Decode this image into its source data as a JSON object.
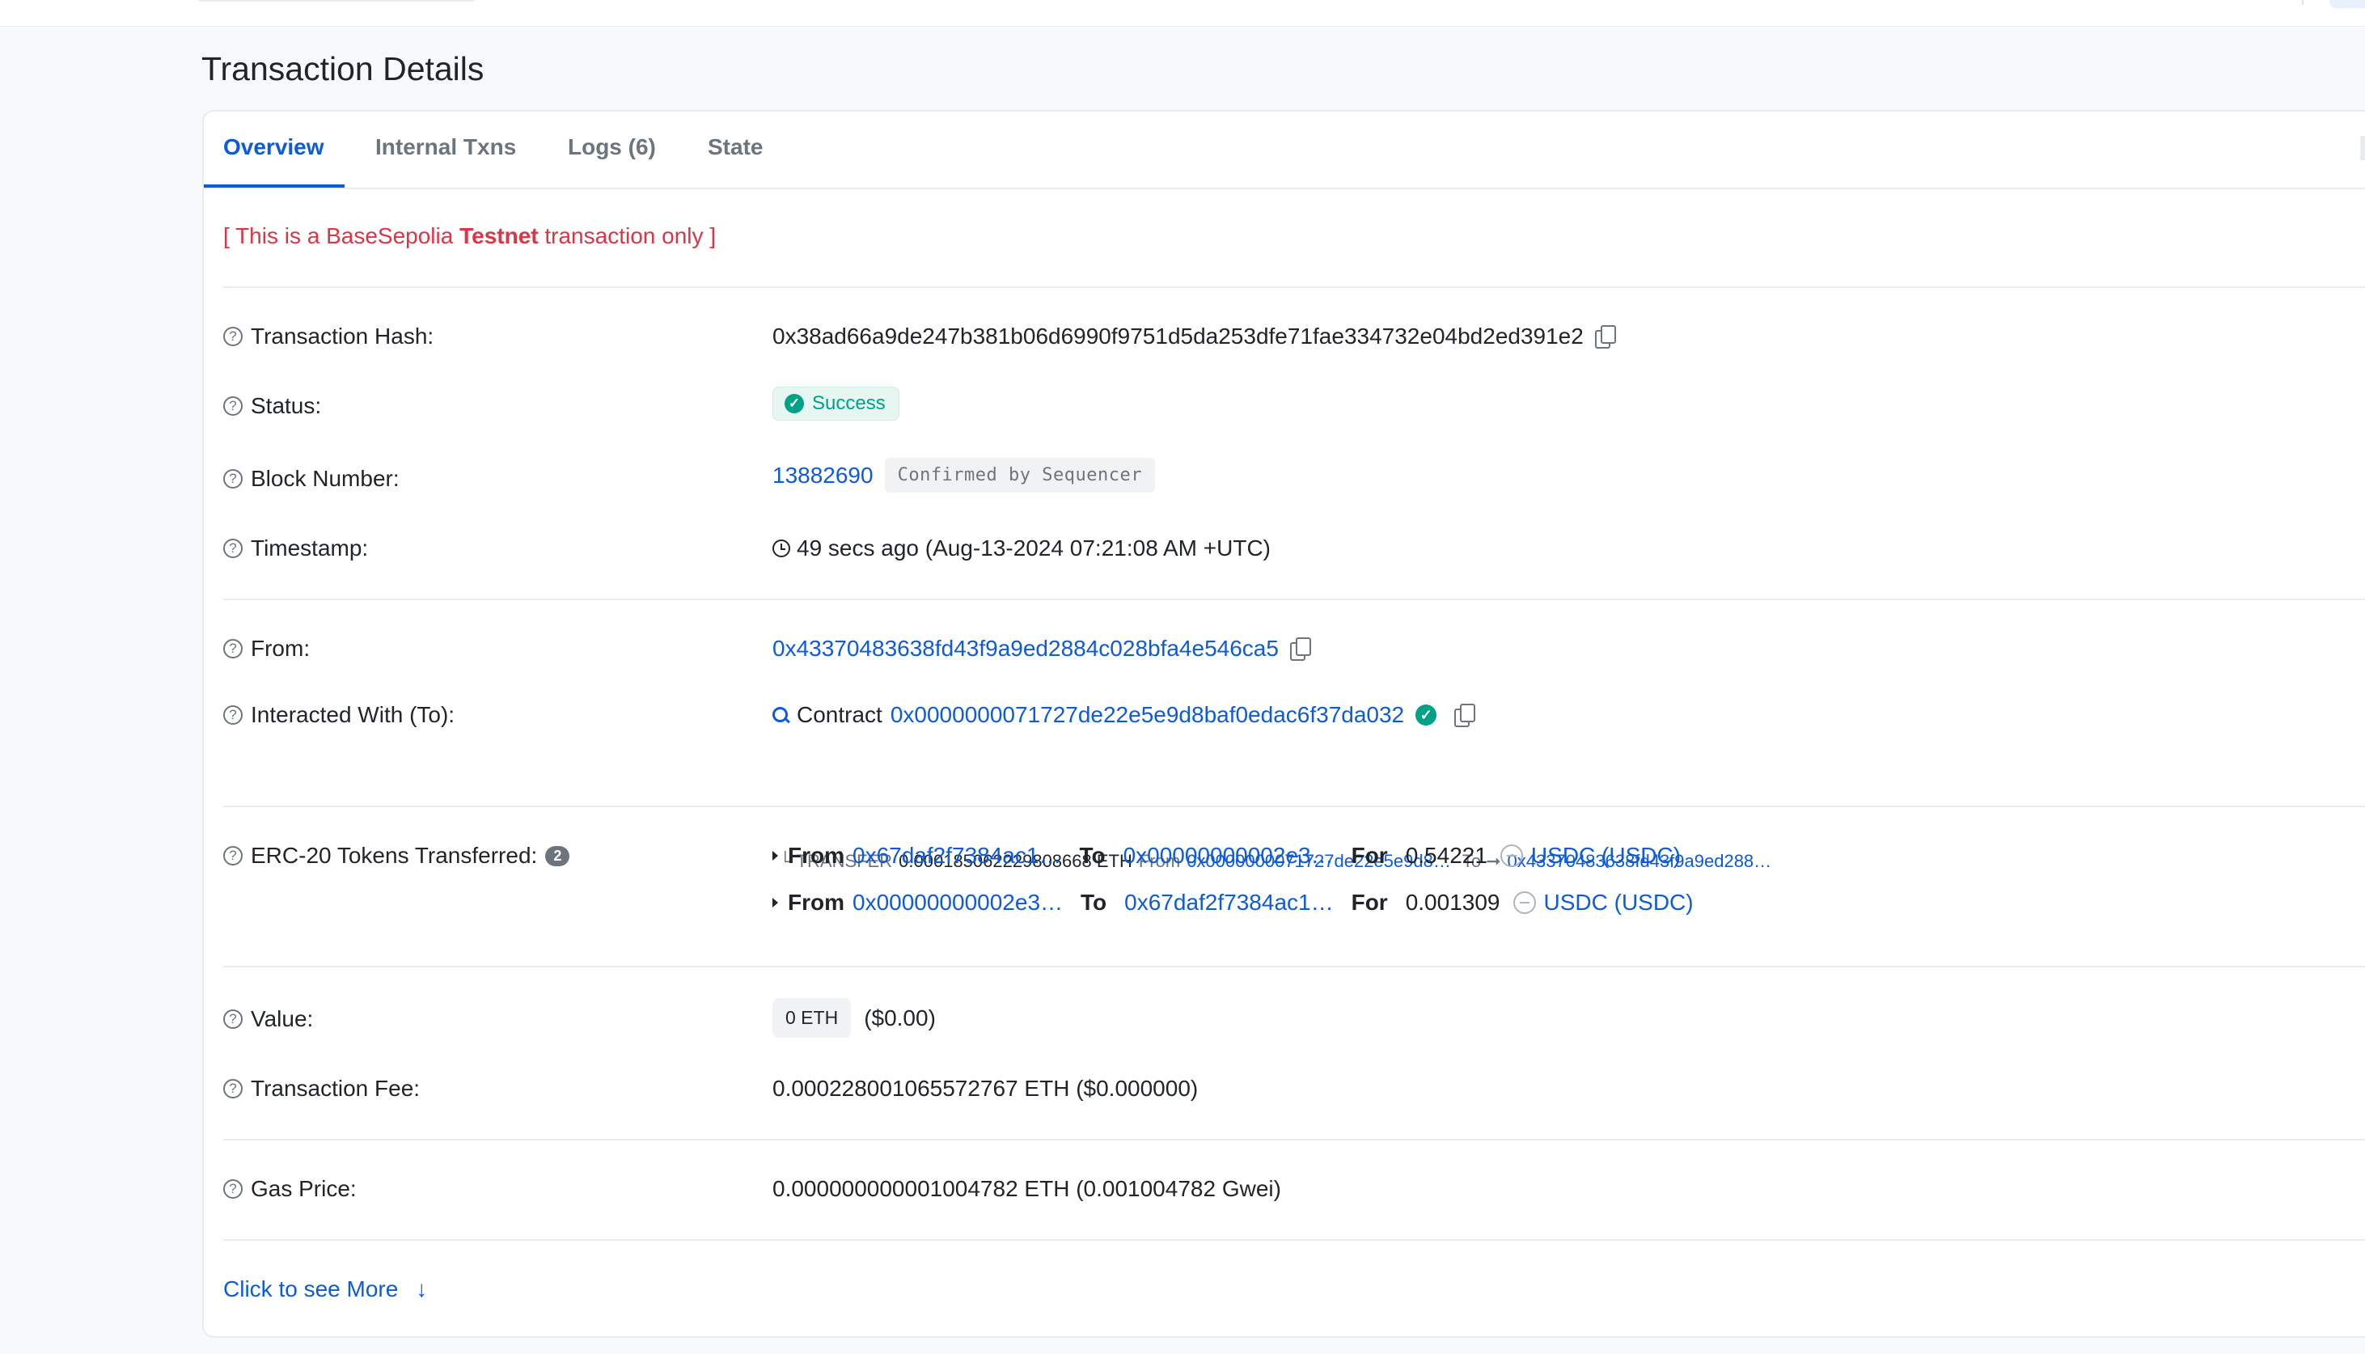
{
  "page_title": "Transaction Details",
  "tabs": [
    {
      "label": "Overview",
      "active": true
    },
    {
      "label": "Internal Txns",
      "active": false
    },
    {
      "label": "Logs (6)",
      "active": false
    },
    {
      "label": "State",
      "active": false
    }
  ],
  "notice": {
    "prefix": "[ This is a BaseSepolia ",
    "strong": "Testnet",
    "suffix": " transaction only ]"
  },
  "rows": {
    "tx_hash": {
      "label": "Transaction Hash:",
      "value": "0x38ad66a9de247b381b06d6990f9751d5da253dfe71fae334732e04bd2ed391e2"
    },
    "status": {
      "label": "Status:",
      "value": "Success"
    },
    "block": {
      "label": "Block Number:",
      "value": "13882690",
      "badge": "Confirmed by Sequencer"
    },
    "timestamp": {
      "label": "Timestamp:",
      "value": "49 secs ago (Aug-13-2024 07:21:08 AM +UTC)"
    },
    "from": {
      "label": "From:",
      "value": "0x43370483638fd43f9a9ed2884c028bfa4e546ca5"
    },
    "to": {
      "label": "Interacted With (To):",
      "prefix": "Contract",
      "value": "0x0000000071727de22e5e9d8baf0edac6f37da032",
      "transfer": {
        "label": "TRANSFER",
        "amount": "0.000185062229808668 ETH",
        "from_label": "From",
        "from": "0x0000000071727de22e5e9d8…",
        "to_label": "To",
        "to": "0x43370483638fd43f9a9ed288…"
      }
    },
    "erc20": {
      "label": "ERC-20 Tokens Transferred:",
      "count": "2",
      "transfers": [
        {
          "from_label": "From",
          "from": "0x67daf2f7384ac1…",
          "to_label": "To",
          "to": "0x00000000002e3…",
          "for_label": "For",
          "amount": "0.54221",
          "token": "USDC (USDC)"
        },
        {
          "from_label": "From",
          "from": "0x00000000002e3…",
          "to_label": "To",
          "to": "0x67daf2f7384ac1…",
          "for_label": "For",
          "amount": "0.001309",
          "token": "USDC (USDC)"
        }
      ]
    },
    "value": {
      "label": "Value:",
      "badge": "0 ETH",
      "usd": "($0.00)"
    },
    "fee": {
      "label": "Transaction Fee:",
      "value": "0.000228001065572767 ETH ($0.000000)"
    },
    "gas": {
      "label": "Gas Price:",
      "value": "0.000000000001004782 ETH (0.001004782 Gwei)"
    }
  },
  "more_link": "Click to see More",
  "icons": {
    "help": "question-circle-icon",
    "copy": "copy-icon",
    "success": "check-circle-icon",
    "clock": "clock-icon",
    "contract": "search-icon",
    "verified": "verified-check-icon",
    "token": "token-icon",
    "expand": "caret-right-icon",
    "more": "arrow-down-icon"
  },
  "colors": {
    "link": "#0d5bd9",
    "success": "#00a186",
    "testnet_notice": "#dc3545",
    "muted": "#6c757d"
  }
}
